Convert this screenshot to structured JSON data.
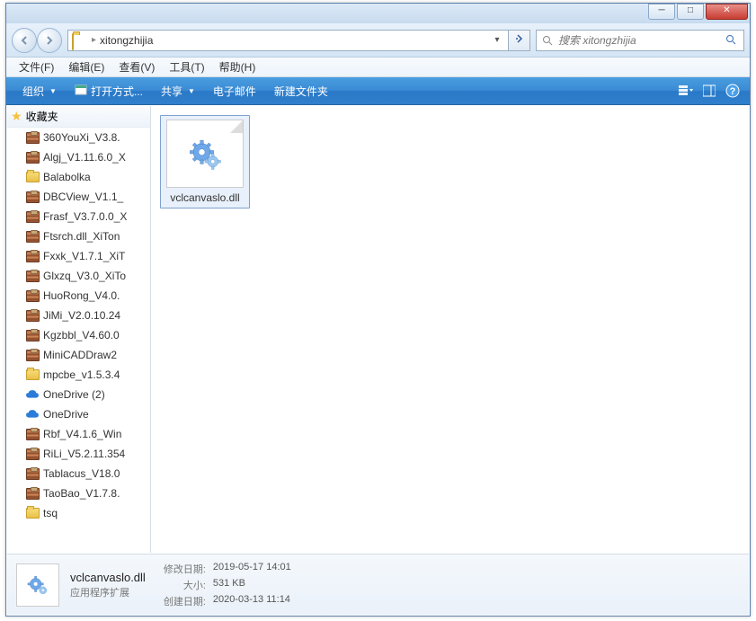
{
  "window": {
    "address_path": "xitongzhijia",
    "search_placeholder": "搜索 xitongzhijia"
  },
  "menu": {
    "file": "文件(F)",
    "edit": "编辑(E)",
    "view": "查看(V)",
    "tools": "工具(T)",
    "help": "帮助(H)"
  },
  "toolbar": {
    "organize": "组织",
    "open_with": "打开方式...",
    "share": "共享",
    "email": "电子邮件",
    "new_folder": "新建文件夹"
  },
  "sidebar": {
    "favorites_label": "收藏夹",
    "items": [
      {
        "label": "360YouXi_V3.8.",
        "icon": "archive"
      },
      {
        "label": "Algj_V1.11.6.0_X",
        "icon": "archive"
      },
      {
        "label": "Balabolka",
        "icon": "folder"
      },
      {
        "label": "DBCView_V1.1_",
        "icon": "archive"
      },
      {
        "label": "Frasf_V3.7.0.0_X",
        "icon": "archive"
      },
      {
        "label": "Ftsrch.dll_XiTon",
        "icon": "archive"
      },
      {
        "label": "Fxxk_V1.7.1_XiT",
        "icon": "archive"
      },
      {
        "label": "Glxzq_V3.0_XiTo",
        "icon": "archive"
      },
      {
        "label": "HuoRong_V4.0.",
        "icon": "archive"
      },
      {
        "label": "JiMi_V2.0.10.24",
        "icon": "archive"
      },
      {
        "label": "Kgzbbl_V4.60.0",
        "icon": "archive"
      },
      {
        "label": "MiniCADDraw2",
        "icon": "archive"
      },
      {
        "label": "mpcbe_v1.5.3.4",
        "icon": "folder"
      },
      {
        "label": "OneDrive (2)",
        "icon": "cloud"
      },
      {
        "label": "OneDrive",
        "icon": "cloud"
      },
      {
        "label": "Rbf_V4.1.6_Win",
        "icon": "archive"
      },
      {
        "label": "RiLi_V5.2.11.354",
        "icon": "archive"
      },
      {
        "label": "Tablacus_V18.0",
        "icon": "archive"
      },
      {
        "label": "TaoBao_V1.7.8.",
        "icon": "archive"
      },
      {
        "label": "tsq",
        "icon": "folder"
      }
    ]
  },
  "content": {
    "file_name": "vclcanvaslo.dll"
  },
  "details": {
    "title": "vclcanvaslo.dll",
    "type": "应用程序扩展",
    "modified_label": "修改日期:",
    "modified_value": "2019-05-17 14:01",
    "size_label": "大小:",
    "size_value": "531 KB",
    "created_label": "创建日期:",
    "created_value": "2020-03-13 11:14"
  }
}
